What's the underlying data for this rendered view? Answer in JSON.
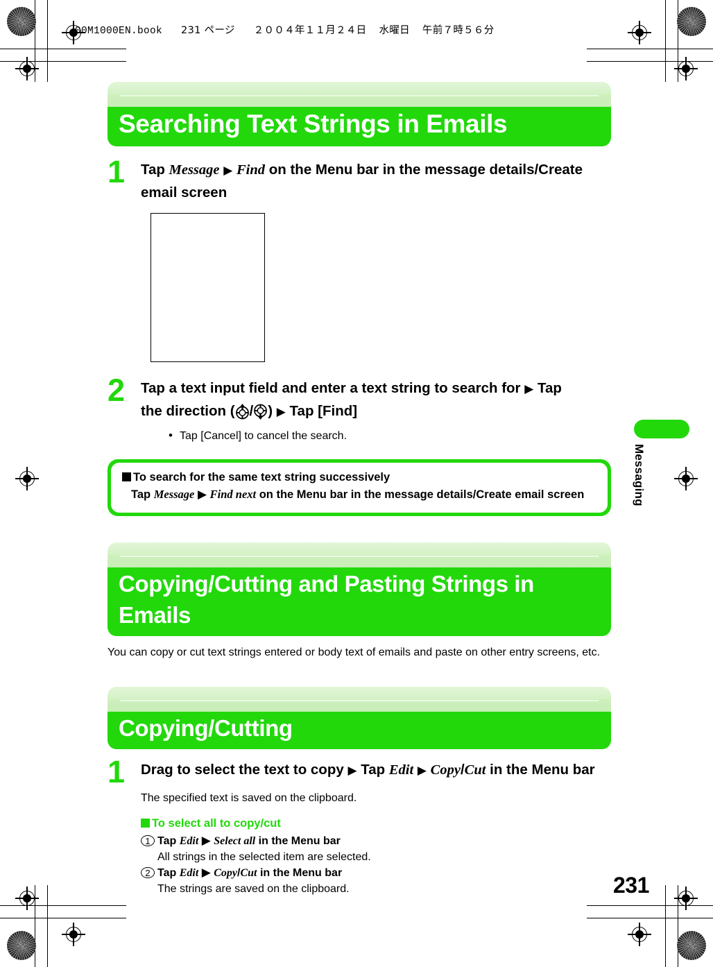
{
  "running_head": {
    "file": "00M1000EN.book",
    "page_label": "231 ページ",
    "date": "２００４年１１月２４日",
    "weekday": "水曜日",
    "time": "午前７時５６分"
  },
  "colors": {
    "accent_green": "#22d80b",
    "banner_cap_light": "#e2f6d9",
    "text_black": "#000000"
  },
  "sections": [
    {
      "heading": "Searching Text Strings in Emails",
      "steps": [
        {
          "number": "1",
          "parts": [
            {
              "t": "Tap ",
              "style": "bold"
            },
            {
              "t": "Message",
              "style": "italic"
            },
            {
              "t": " ",
              "style": "bold"
            },
            {
              "t": "▶",
              "style": "arrow"
            },
            {
              "t": " ",
              "style": "bold"
            },
            {
              "t": "Find",
              "style": "italic"
            },
            {
              "t": " on the Menu bar in the message details/Create email screen",
              "style": "bold"
            }
          ]
        }
      ]
    }
  ],
  "step2": {
    "number": "2",
    "line1_a": " Tap a text input field and enter a text string to search for ",
    "arrow": "▶",
    "line1_b": " Tap",
    "line2_a": "the direction (",
    "line2_sep": "/",
    "line2_b": ") ",
    "line2_c": " Tap [Find]",
    "bullets": [
      "Tap [Cancel] to cancel the search."
    ],
    "icon_up": "dpad-up-icon",
    "icon_down": "dpad-down-icon"
  },
  "note1": {
    "title": "To search for the same text string successively",
    "body": [
      {
        "t": "Tap ",
        "style": "bold"
      },
      {
        "t": "Message",
        "style": "italic"
      },
      {
        "t": " ",
        "style": "bold"
      },
      {
        "t": "▶",
        "style": "arrow"
      },
      {
        "t": " ",
        "style": "bold"
      },
      {
        "t": "Find next",
        "style": "italic"
      },
      {
        "t": " on the Menu bar in the message details/Create email screen",
        "style": "bold"
      }
    ]
  },
  "section2": {
    "heading": "Copying/Cutting and Pasting Strings in Emails",
    "intro": "You can copy or cut text strings entered or body text of emails and paste on other entry screens, etc."
  },
  "section3": {
    "heading": "Copying/Cutting",
    "step": {
      "number": "1",
      "parts": [
        {
          "t": "Drag to select the text to copy ",
          "style": "bold"
        },
        {
          "t": "▶",
          "style": "arrow"
        },
        {
          "t": " Tap ",
          "style": "bold"
        },
        {
          "t": "Edit",
          "style": "italic"
        },
        {
          "t": " ",
          "style": "bold"
        },
        {
          "t": "▶",
          "style": "arrow"
        },
        {
          "t": " ",
          "style": "bold"
        },
        {
          "t": "Copy",
          "style": "italic"
        },
        {
          "t": "/",
          "style": "bold"
        },
        {
          "t": "Cut",
          "style": "italic"
        },
        {
          "t": " in the Menu bar",
          "style": "bold"
        }
      ],
      "result": "The specified text is saved on the clipboard."
    },
    "subblock": {
      "title": "To select all to copy/cut",
      "items": [
        {
          "num": "1",
          "parts": [
            {
              "t": "Tap ",
              "style": "bold"
            },
            {
              "t": "Edit",
              "style": "italic"
            },
            {
              "t": " ",
              "style": "bold"
            },
            {
              "t": "▶",
              "style": "arrow"
            },
            {
              "t": " ",
              "style": "bold"
            },
            {
              "t": "Select all",
              "style": "italic"
            },
            {
              "t": " in the Menu bar",
              "style": "bold"
            }
          ],
          "desc": "All strings in the selected item are selected."
        },
        {
          "num": "2",
          "parts": [
            {
              "t": "Tap ",
              "style": "bold"
            },
            {
              "t": "Edit",
              "style": "italic"
            },
            {
              "t": " ",
              "style": "bold"
            },
            {
              "t": "▶",
              "style": "arrow"
            },
            {
              "t": " ",
              "style": "bold"
            },
            {
              "t": "Copy",
              "style": "italic"
            },
            {
              "t": "/",
              "style": "bold"
            },
            {
              "t": "Cut",
              "style": "italic"
            },
            {
              "t": " in the Menu bar",
              "style": "bold"
            }
          ],
          "desc": "The strings are saved on the clipboard."
        }
      ]
    }
  },
  "thumb_tab": {
    "label": "Messaging"
  },
  "folio": {
    "page_number": "231"
  }
}
